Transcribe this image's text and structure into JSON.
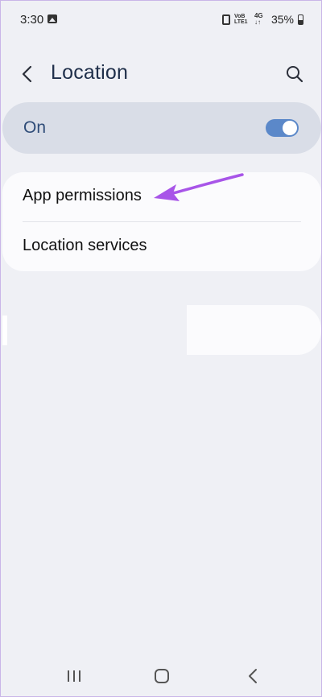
{
  "status_bar": {
    "time": "3:30",
    "gallery_icon": "image-notification-icon",
    "sim_icon": "sim-card-icon",
    "volte_line1": "VoB",
    "volte_line2": "LTE1",
    "network": "4G",
    "network_sub": "↓↑",
    "battery_percent": "35%",
    "battery_icon": "battery-icon"
  },
  "header": {
    "back_icon": "chevron-left-icon",
    "title": "Location",
    "search_icon": "search-icon"
  },
  "master_switch": {
    "label": "On",
    "state": "on",
    "accent_color": "#5b88c9"
  },
  "settings": {
    "items": [
      {
        "label": "App permissions"
      },
      {
        "label": "Location services"
      }
    ]
  },
  "annotation": {
    "arrow_color": "#a855e8",
    "icon": "arrow-annotation-icon"
  },
  "nav_bar": {
    "recents_icon": "recents-icon",
    "home_icon": "home-icon",
    "back_icon": "back-icon"
  }
}
